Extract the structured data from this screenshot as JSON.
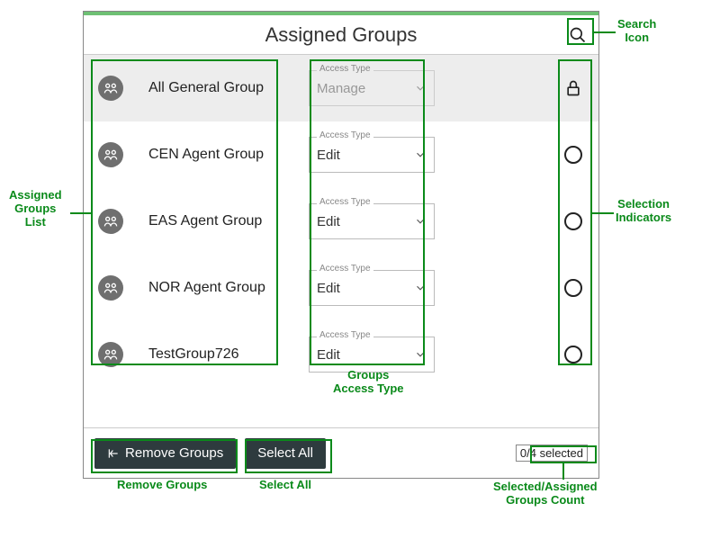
{
  "header": {
    "title": "Assigned Groups"
  },
  "accessTypeLabel": "Access Type",
  "rows": [
    {
      "name": "All General Group",
      "access": "Manage",
      "locked": true
    },
    {
      "name": "CEN Agent Group",
      "access": "Edit",
      "locked": false
    },
    {
      "name": "EAS Agent Group",
      "access": "Edit",
      "locked": false
    },
    {
      "name": "NOR Agent Group",
      "access": "Edit",
      "locked": false
    },
    {
      "name": "TestGroup726",
      "access": "Edit",
      "locked": false
    }
  ],
  "footer": {
    "removeLabel": "Remove Groups",
    "selectAllLabel": "Select All",
    "selectedCount": "0/4 selected"
  },
  "annotations": {
    "searchIcon": "Search\nIcon",
    "assignedGroupsList": "Assigned\nGroups\nList",
    "selectionIndicators": "Selection\nIndicators",
    "groupsAccessType": "Groups\nAccess Type",
    "removeGroups": "Remove Groups",
    "selectAll": "Select All",
    "selectedAssignedCount": "Selected/Assigned\nGroups Count"
  }
}
